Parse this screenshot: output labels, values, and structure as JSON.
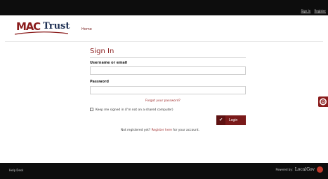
{
  "top_links": {
    "sign_in": "Sign In",
    "register": "Register"
  },
  "brand": {
    "logo_part1": "MAC",
    "logo_part2": "Trust",
    "accent": "#8a1c1c",
    "navy": "#1d2f53"
  },
  "nav": {
    "home": "Home"
  },
  "form": {
    "title": "Sign In",
    "username_label": "Username or email",
    "username_value": "",
    "password_label": "Password",
    "password_value": "",
    "forgot": "Forgot your password?",
    "keep_signed_in": "Keep me signed in (I'm not on a shared computer)",
    "login_button": "Login",
    "register_prefix": "Not registered yet?",
    "register_link": "Register here",
    "register_suffix": "for your account."
  },
  "footer": {
    "help_desk": "Help Desk",
    "powered_by": "Powered by:",
    "provider": "LocalGov"
  }
}
